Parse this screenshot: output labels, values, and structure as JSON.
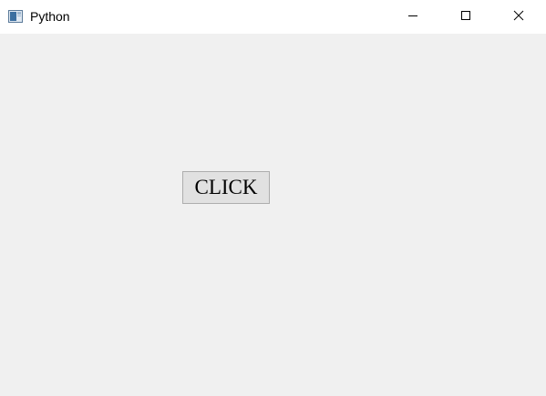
{
  "window": {
    "title": "Python",
    "icon": "python-window-icon",
    "controls": [
      "minimize-icon",
      "maximize-icon",
      "close-icon"
    ]
  },
  "main": {
    "click_button_label": "CLICK"
  },
  "colors": {
    "titlebar_bg": "#ffffff",
    "client_bg": "#f0f0f0",
    "button_bg": "#e1e1e1",
    "button_border": "#adadad"
  }
}
